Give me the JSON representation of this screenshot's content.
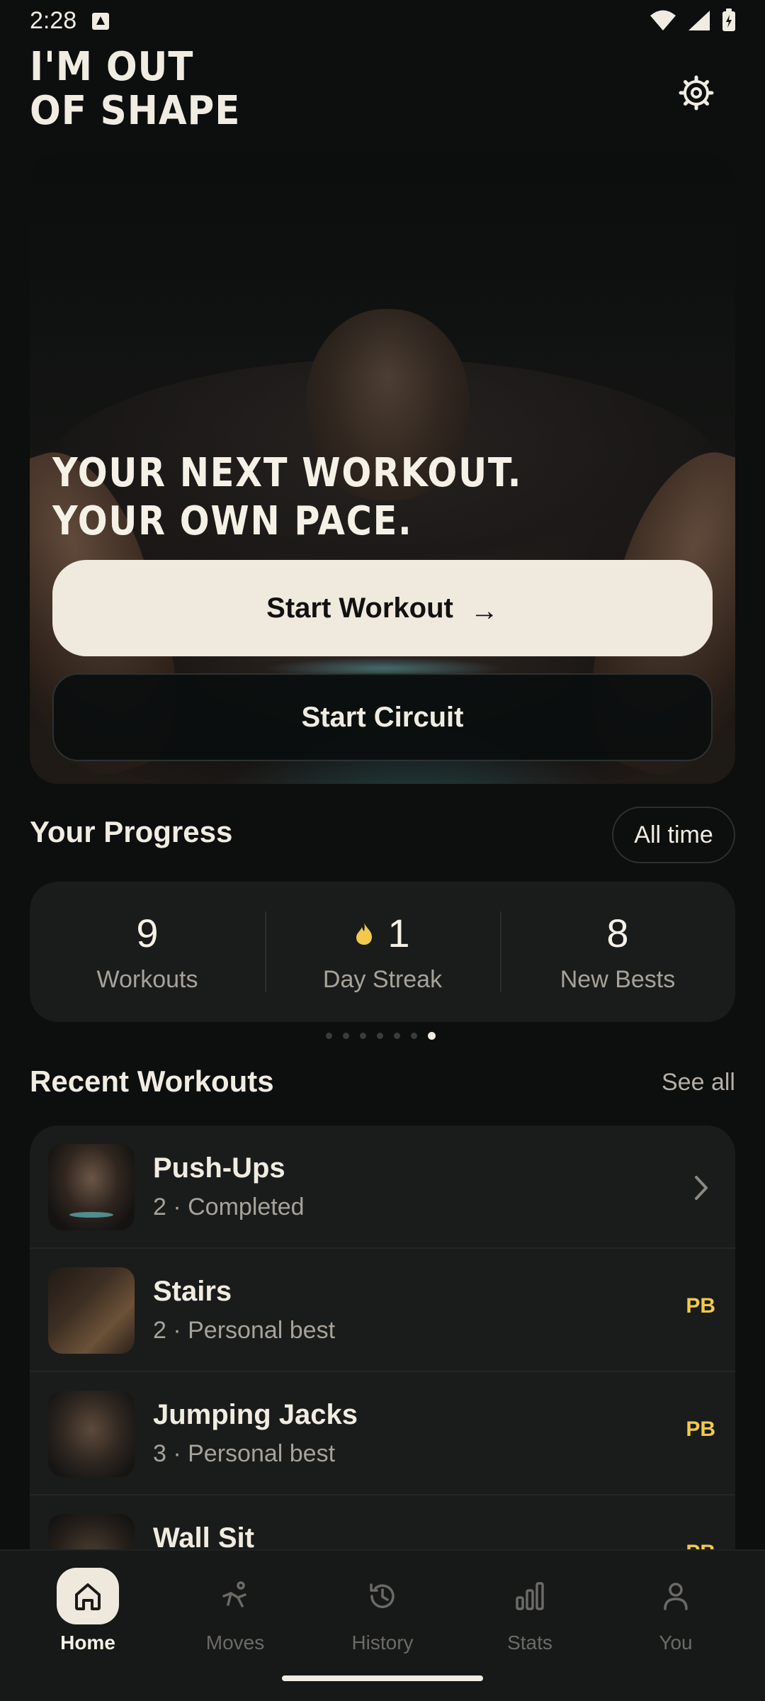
{
  "status_bar": {
    "time": "2:28"
  },
  "header": {
    "title_line1": "I'M OUT",
    "title_line2": "OF SHAPE",
    "settings_icon": "settings-icon"
  },
  "hero": {
    "tagline_line1": "YOUR NEXT WORKOUT.",
    "tagline_line2": "YOUR OWN PACE.",
    "start_workout_label": "Start Workout",
    "start_workout_arrow": "→",
    "start_circuit_label": "Start Circuit"
  },
  "progress": {
    "title": "Your Progress",
    "filter_label": "All time",
    "stats": [
      {
        "value": "9",
        "label": "Workouts"
      },
      {
        "value": "1",
        "label": "Day Streak",
        "icon": "flame-icon"
      },
      {
        "value": "8",
        "label": "New Bests"
      }
    ],
    "pager": {
      "count": 7,
      "active_index": 6
    }
  },
  "recent": {
    "title": "Recent Workouts",
    "see_all_label": "See all",
    "items": [
      {
        "name": "Push-Ups",
        "subtitle": "2 · Completed",
        "trailing": "chevron"
      },
      {
        "name": "Stairs",
        "subtitle": "2 · Personal best",
        "trailing": "PB"
      },
      {
        "name": "Jumping Jacks",
        "subtitle": "3 · Personal best",
        "trailing": "PB"
      },
      {
        "name": "Wall Sit",
        "subtitle": "",
        "trailing": "PB"
      }
    ]
  },
  "bottom_nav": {
    "items": [
      {
        "label": "Home",
        "icon": "home-icon",
        "active": true
      },
      {
        "label": "Moves",
        "icon": "moves-icon",
        "active": false
      },
      {
        "label": "History",
        "icon": "history-icon",
        "active": false
      },
      {
        "label": "Stats",
        "icon": "stats-icon",
        "active": false
      },
      {
        "label": "You",
        "icon": "profile-icon",
        "active": false
      }
    ]
  },
  "colors": {
    "background": "#0d0e0e",
    "card": "#1a1c1b",
    "primary_button": "#f0e9dd",
    "accent_pb": "#f2c94c",
    "streak_flame": "#f2c94c"
  }
}
